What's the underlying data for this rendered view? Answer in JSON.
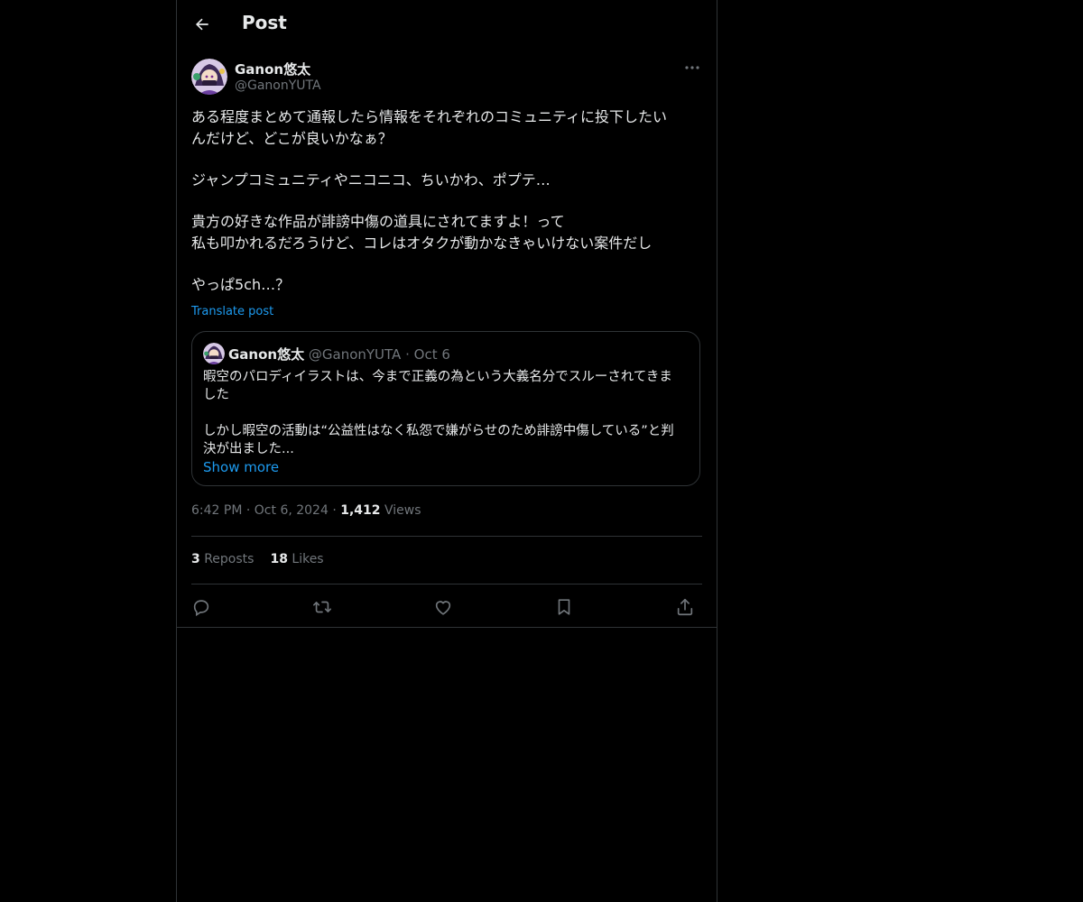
{
  "header": {
    "back_icon": "arrow-left-icon",
    "title": "Post"
  },
  "post": {
    "author": {
      "name": "Ganon悠太",
      "handle": "@GanonYUTA"
    },
    "text_lines": [
      "ある程度まとめて通報したら情報をそれぞれのコミュニティに投下したい",
      "んだけど、どこが良いかなぁ？",
      "",
      "ジャンプコミュニティやニコニコ、ちいかわ、ポプテ…",
      "",
      "貴方の好きな作品が誹謗中傷の道具にされてますよ！って",
      "私も叩かれるだろうけど、コレはオタクが動かなきゃいけない案件だし",
      "",
      "やっぱ5ch…？"
    ],
    "translate_label": "Translate post",
    "quote": {
      "name": "Ganon悠太",
      "handle": "@GanonYUTA",
      "separator": "·",
      "date": "Oct 6",
      "text_lines": [
        "暇空のパロディイラストは、今まで正義の為という大義名分でスルーされてきま",
        "した",
        "",
        "しかし暇空の活動は“公益性はなく私怨で嫌がらせのため誹謗中傷している”と判",
        "決が出ました..."
      ],
      "show_more": "Show more"
    },
    "time": "6:42 PM",
    "date": "Oct 6, 2024",
    "separator": "·",
    "views_count": "1,412",
    "views_label": "Views",
    "reposts_count": "3",
    "reposts_label": "Reposts",
    "likes_count": "18",
    "likes_label": "Likes"
  },
  "actions": [
    "reply-icon",
    "repost-icon",
    "like-icon",
    "bookmark-icon",
    "share-icon"
  ],
  "colors": {
    "background": "#000000",
    "text": "#e7e9ea",
    "secondary": "#71767b",
    "link": "#1d9bf0",
    "border": "#2f3336"
  }
}
